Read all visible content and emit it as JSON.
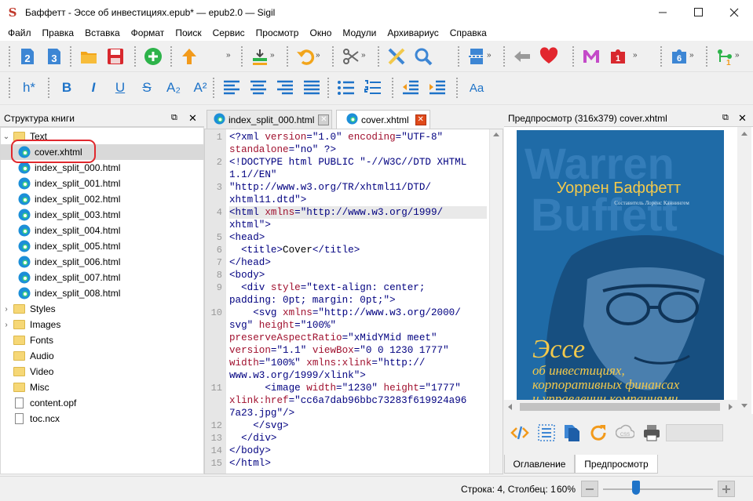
{
  "window": {
    "title": "Баффетт - Эссе об инвестициях.epub* — epub2.0 — Sigil",
    "app_icon": "sigil-icon"
  },
  "menu": [
    "Файл",
    "Правка",
    "Вставка",
    "Формат",
    "Поиск",
    "Сервис",
    "Просмотр",
    "Окно",
    "Модули",
    "Архивариус",
    "Справка"
  ],
  "toolbar1": [
    {
      "icon": "h2-icon"
    },
    {
      "icon": "h3-icon"
    },
    {
      "icon": "open-folder-icon"
    },
    {
      "icon": "save-icon"
    },
    {
      "icon": "add-icon"
    },
    {
      "icon": "upload-arrow-icon"
    },
    {
      "icon": "insert-icon"
    },
    {
      "icon": "undo-icon"
    },
    {
      "icon": "cut-icon"
    },
    {
      "icon": "spellcheck-icon"
    },
    {
      "icon": "search-icon"
    },
    {
      "icon": "split-icon"
    },
    {
      "icon": "back-arrow-icon"
    },
    {
      "icon": "donate-heart-icon"
    },
    {
      "icon": "m-plugin-icon"
    },
    {
      "icon": "plugin-1-icon"
    },
    {
      "icon": "plugin-6-icon"
    },
    {
      "icon": "plugin-1b-icon"
    }
  ],
  "toolbar2": {
    "heading_label": "h*",
    "buttons": [
      "B",
      "I",
      "U",
      "S",
      "A₂",
      "A²"
    ],
    "style_label": "Aa"
  },
  "book_browser": {
    "title": "Структура книги",
    "items": [
      {
        "label": "Text",
        "type": "folder",
        "expanded": true
      },
      {
        "label": "cover.xhtml",
        "type": "xhtml",
        "selected": true
      },
      {
        "label": "index_split_000.html",
        "type": "xhtml"
      },
      {
        "label": "index_split_001.html",
        "type": "xhtml"
      },
      {
        "label": "index_split_002.html",
        "type": "xhtml"
      },
      {
        "label": "index_split_003.html",
        "type": "xhtml"
      },
      {
        "label": "index_split_004.html",
        "type": "xhtml"
      },
      {
        "label": "index_split_005.html",
        "type": "xhtml"
      },
      {
        "label": "index_split_006.html",
        "type": "xhtml"
      },
      {
        "label": "index_split_007.html",
        "type": "xhtml"
      },
      {
        "label": "index_split_008.html",
        "type": "xhtml"
      },
      {
        "label": "Styles",
        "type": "folder",
        "collapsed": true
      },
      {
        "label": "Images",
        "type": "folder",
        "collapsed": true
      },
      {
        "label": "Fonts",
        "type": "folder"
      },
      {
        "label": "Audio",
        "type": "folder"
      },
      {
        "label": "Video",
        "type": "folder"
      },
      {
        "label": "Misc",
        "type": "folder"
      },
      {
        "label": "content.opf",
        "type": "file"
      },
      {
        "label": "toc.ncx",
        "type": "file"
      }
    ]
  },
  "tabs": [
    {
      "label": "index_split_000.html",
      "active": false
    },
    {
      "label": "cover.xhtml",
      "active": true
    }
  ],
  "code_lines": [
    {
      "n": "1",
      "parts": [
        [
          "tg",
          "<?xml "
        ],
        [
          "at",
          "version"
        ],
        [
          "tg",
          "=\"1.0\" "
        ],
        [
          "at",
          "encoding"
        ],
        [
          "tg",
          "=\"UTF-8\""
        ]
      ]
    },
    {
      "n": "",
      "parts": [
        [
          "at",
          "standalone"
        ],
        [
          "tg",
          "=\"no\" ?>"
        ]
      ]
    },
    {
      "n": "2",
      "parts": [
        [
          "tg",
          "<!DOCTYPE html PUBLIC \"-//W3C//DTD XHTML"
        ]
      ]
    },
    {
      "n": "",
      "parts": [
        [
          "tg",
          "1.1//EN\""
        ]
      ]
    },
    {
      "n": "3",
      "parts": [
        [
          "tg",
          "\"http://www.w3.org/TR/xhtml11/DTD/"
        ]
      ]
    },
    {
      "n": "",
      "parts": [
        [
          "tg",
          "xhtml11.dtd\">"
        ]
      ]
    },
    {
      "n": "4",
      "cur": true,
      "parts": [
        [
          "tg",
          "<html "
        ],
        [
          "at",
          "xmlns"
        ],
        [
          "tg",
          "=\"http://www.w3.org/1999/"
        ]
      ]
    },
    {
      "n": "",
      "parts": [
        [
          "tg",
          "xhtml\">"
        ]
      ]
    },
    {
      "n": "5",
      "parts": [
        [
          "tg",
          "<head>"
        ]
      ]
    },
    {
      "n": "6",
      "parts": [
        [
          "tg",
          "  <title>"
        ],
        [
          "plain",
          "Cover"
        ],
        [
          "tg",
          "</title>"
        ]
      ]
    },
    {
      "n": "7",
      "parts": [
        [
          "tg",
          "</head>"
        ]
      ]
    },
    {
      "n": "8",
      "parts": [
        [
          "tg",
          "<body>"
        ]
      ]
    },
    {
      "n": "9",
      "parts": [
        [
          "tg",
          "  <div "
        ],
        [
          "at",
          "style"
        ],
        [
          "tg",
          "=\"text-align: center;"
        ]
      ]
    },
    {
      "n": "",
      "parts": [
        [
          "tg",
          "padding: 0pt; margin: 0pt;\">"
        ]
      ]
    },
    {
      "n": "10",
      "parts": [
        [
          "tg",
          "    <svg "
        ],
        [
          "at",
          "xmlns"
        ],
        [
          "tg",
          "=\"http://www.w3.org/2000/"
        ]
      ]
    },
    {
      "n": "",
      "parts": [
        [
          "tg",
          "svg\" "
        ],
        [
          "at",
          "height"
        ],
        [
          "tg",
          "=\"100%\""
        ]
      ]
    },
    {
      "n": "",
      "parts": [
        [
          "at",
          "preserveAspectRatio"
        ],
        [
          "tg",
          "=\"xMidYMid meet\""
        ]
      ]
    },
    {
      "n": "",
      "parts": [
        [
          "at",
          "version"
        ],
        [
          "tg",
          "=\"1.1\" "
        ],
        [
          "at",
          "viewBox"
        ],
        [
          "tg",
          "=\"0 0 1230 1777\""
        ]
      ]
    },
    {
      "n": "",
      "parts": [
        [
          "at",
          "width"
        ],
        [
          "tg",
          "=\"100%\" "
        ],
        [
          "at",
          "xmlns:xlink"
        ],
        [
          "tg",
          "=\"http://"
        ]
      ]
    },
    {
      "n": "",
      "parts": [
        [
          "tg",
          "www.w3.org/1999/xlink\">"
        ]
      ]
    },
    {
      "n": "11",
      "parts": [
        [
          "tg",
          "      <image "
        ],
        [
          "at",
          "width"
        ],
        [
          "tg",
          "=\"1230\" "
        ],
        [
          "at",
          "height"
        ],
        [
          "tg",
          "=\"1777\""
        ]
      ]
    },
    {
      "n": "",
      "parts": [
        [
          "at",
          "xlink:href"
        ],
        [
          "tg",
          "=\"cc6a7dab96bbc73283f619924a96"
        ]
      ]
    },
    {
      "n": "",
      "parts": [
        [
          "tg",
          "7a23.jpg\"/>"
        ]
      ]
    },
    {
      "n": "12",
      "parts": [
        [
          "tg",
          "    </svg>"
        ]
      ]
    },
    {
      "n": "13",
      "parts": [
        [
          "tg",
          "  </div>"
        ]
      ]
    },
    {
      "n": "14",
      "parts": [
        [
          "tg",
          "</body>"
        ]
      ]
    },
    {
      "n": "15",
      "parts": [
        [
          "tg",
          "</html>"
        ]
      ]
    }
  ],
  "preview": {
    "title": "Предпросмотр (316x379) cover.xhtml",
    "cover": {
      "bg_words": [
        "Warren",
        "Buffett"
      ],
      "author": "Уоррен Баффетт",
      "compiler": "Составитель Лоренс Каннингем",
      "title": "Эссе",
      "subtitle": [
        "об инвестициях,",
        "корпоративных финансах",
        "и управлении компаниями"
      ]
    },
    "tabs": [
      {
        "label": "Оглавление",
        "active": false
      },
      {
        "label": "Предпросмотр",
        "active": true
      }
    ]
  },
  "status": {
    "position": "Строка: 4, Столбец: 1",
    "zoom": "60%",
    "zoom_level": 0.3
  },
  "colors": {
    "accent": "#1e73c8",
    "cover_bg": "#1f6ba7",
    "cover_text": "#f2c94c",
    "highlight": "#e0282d"
  }
}
